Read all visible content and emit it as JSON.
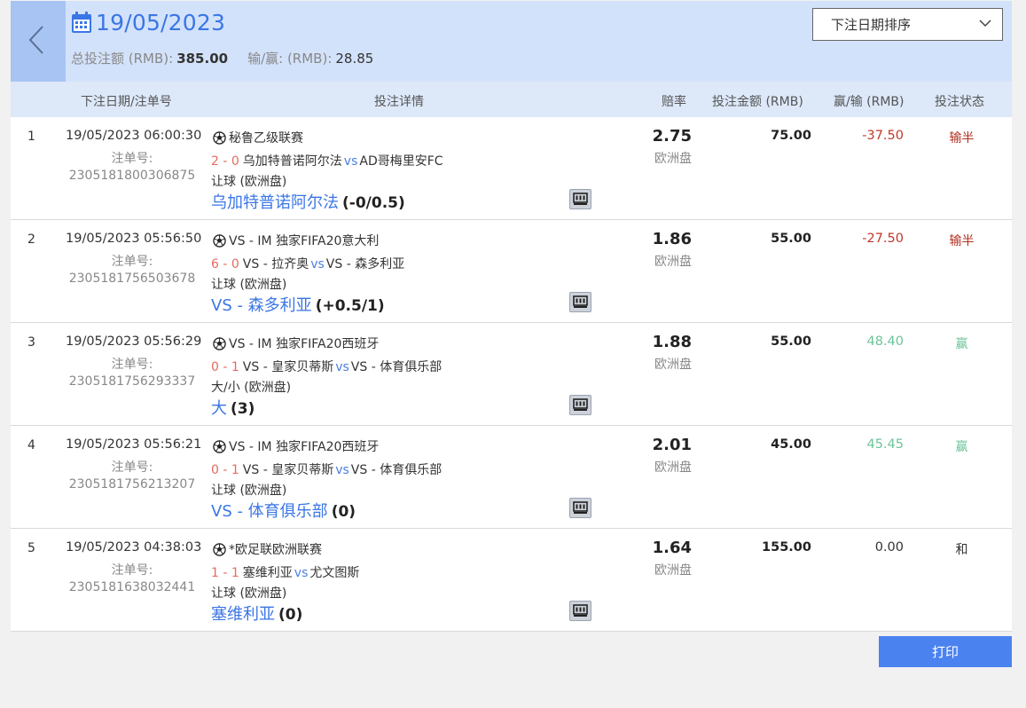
{
  "header": {
    "date": "19/05/2023",
    "total_stake_label": "总投注额 (RMB):",
    "total_stake_value": "385.00",
    "winloss_label": "输/赢: (RMB):",
    "winloss_value": "28.85"
  },
  "sort": {
    "selected": "下注日期排序"
  },
  "columns": {
    "date_ticket": "下注日期/注单号",
    "details": "投注详情",
    "odds": "赔率",
    "stake": "投注金额 (RMB)",
    "winloss": "赢/输 (RMB)",
    "status": "投注状态"
  },
  "colors": {
    "accent": "#3a76e6",
    "score": "#e56b5d",
    "lose": "#c0392b",
    "win": "#6cc49a",
    "draw": "#333333"
  },
  "rows": [
    {
      "index": "1",
      "datetime": "19/05/2023 06:00:30",
      "ticket_label": "注单号:",
      "ticket_no": "2305181800306875",
      "league": "秘鲁乙级联赛",
      "score": "2 - 0",
      "home": "乌加特普诺阿尔法",
      "vs": "vs",
      "away": "AD哥梅里安FC",
      "market": "让球 (欧洲盘)",
      "pick": "乌加特普诺阿尔法",
      "line": "(-0/0.5)",
      "odds": "2.75",
      "odds_type": "欧洲盘",
      "stake": "75.00",
      "winloss": "-37.50",
      "winloss_kind": "lose",
      "status": "输半"
    },
    {
      "index": "2",
      "datetime": "19/05/2023 05:56:50",
      "ticket_label": "注单号:",
      "ticket_no": "2305181756503678",
      "league": "VS - IM 独家FIFA20意大利",
      "score": "6 - 0",
      "home": "VS - 拉齐奥",
      "vs": "vs",
      "away": "VS - 森多利亚",
      "market": "让球 (欧洲盘)",
      "pick": "VS - 森多利亚",
      "line": "(+0.5/1)",
      "odds": "1.86",
      "odds_type": "欧洲盘",
      "stake": "55.00",
      "winloss": "-27.50",
      "winloss_kind": "lose",
      "status": "输半"
    },
    {
      "index": "3",
      "datetime": "19/05/2023 05:56:29",
      "ticket_label": "注单号:",
      "ticket_no": "2305181756293337",
      "league": "VS - IM 独家FIFA20西班牙",
      "score": "0 - 1",
      "home": "VS - 皇家贝蒂斯",
      "vs": "vs",
      "away": "VS - 体育俱乐部",
      "market": "大/小 (欧洲盘)",
      "pick": "大",
      "line": "(3)",
      "odds": "1.88",
      "odds_type": "欧洲盘",
      "stake": "55.00",
      "winloss": "48.40",
      "winloss_kind": "win",
      "status": "赢"
    },
    {
      "index": "4",
      "datetime": "19/05/2023 05:56:21",
      "ticket_label": "注单号:",
      "ticket_no": "2305181756213207",
      "league": "VS - IM 独家FIFA20西班牙",
      "score": "0 - 1",
      "home": "VS - 皇家贝蒂斯",
      "vs": "vs",
      "away": "VS - 体育俱乐部",
      "market": "让球 (欧洲盘)",
      "pick": "VS - 体育俱乐部",
      "line": "(0)",
      "odds": "2.01",
      "odds_type": "欧洲盘",
      "stake": "45.00",
      "winloss": "45.45",
      "winloss_kind": "win",
      "status": "赢"
    },
    {
      "index": "5",
      "datetime": "19/05/2023 04:38:03",
      "ticket_label": "注单号:",
      "ticket_no": "2305181638032441",
      "league": "*欧足联欧洲联赛",
      "score": "1 - 1",
      "home": "塞维利亚",
      "vs": "vs",
      "away": "尤文图斯",
      "market": "让球 (欧洲盘)",
      "pick": "塞维利亚",
      "line": "(0)",
      "odds": "1.64",
      "odds_type": "欧洲盘",
      "stake": "155.00",
      "winloss": "0.00",
      "winloss_kind": "draw",
      "status": "和"
    }
  ],
  "print_label": "打印"
}
